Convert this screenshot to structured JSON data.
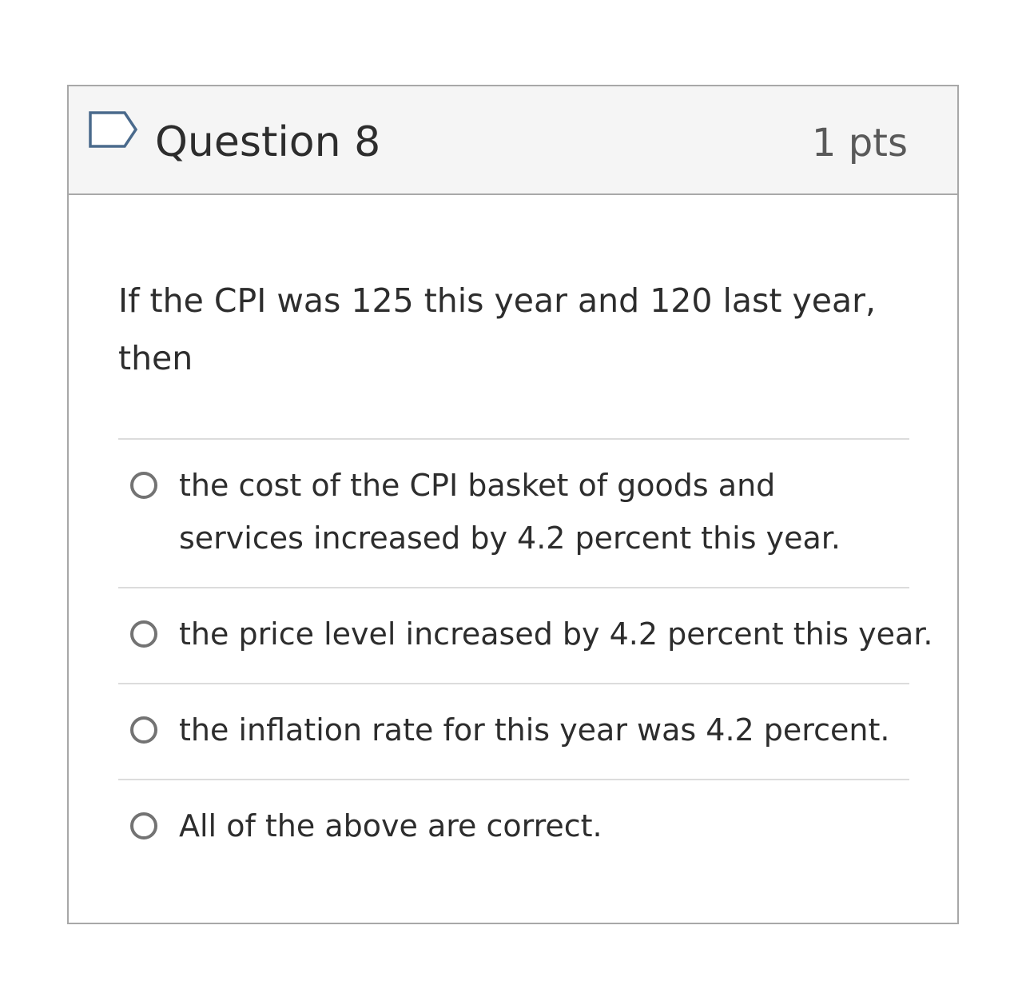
{
  "question": {
    "title": "Question 8",
    "points": "1 pts",
    "flag_icon": "bookmark-flag-icon",
    "text": "If the CPI was 125 this year and 120 last year, then"
  },
  "answers": [
    {
      "label": "the cost of the CPI basket of goods and services increased by 4.2 percent this year.",
      "selected": false
    },
    {
      "label": "the price level increased by 4.2 percent this year.",
      "selected": false
    },
    {
      "label": "the inflation rate for this year was 4.2 percent.",
      "selected": false
    },
    {
      "label": "All of the above are correct.",
      "selected": false
    }
  ],
  "colors": {
    "header_background": "#f5f5f5",
    "border": "#a8a8a8",
    "flag_stroke": "#4a6a8c",
    "text": "#2d2d2d",
    "points_text": "#595959",
    "radio_border": "#737373"
  }
}
